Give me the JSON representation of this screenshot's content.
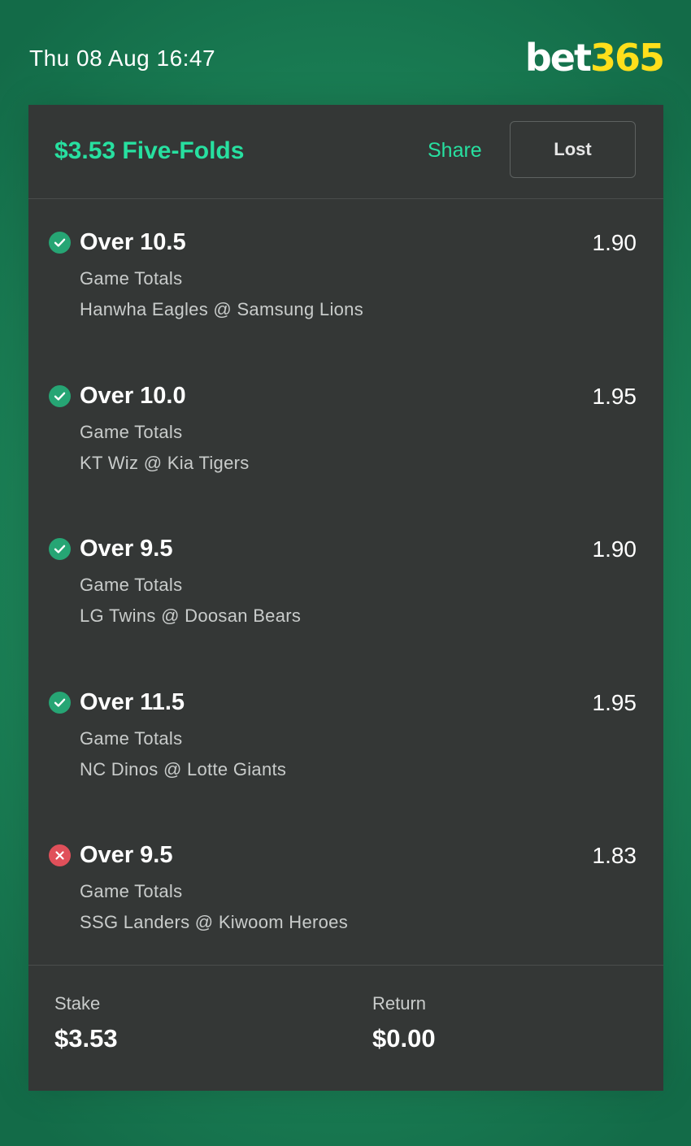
{
  "header": {
    "datetime": "Thu 08 Aug 16:47",
    "logo_part1": "bet",
    "logo_part2": "365"
  },
  "bet": {
    "title": "$3.53 Five-Folds",
    "share_label": "Share",
    "status_label": "Lost"
  },
  "selections": [
    {
      "name": "Over 10.5",
      "odds": "1.90",
      "market": "Game Totals",
      "event": "Hanwha Eagles @ Samsung Lions",
      "result": "won"
    },
    {
      "name": "Over 10.0",
      "odds": "1.95",
      "market": "Game Totals",
      "event": "KT Wiz @ Kia Tigers",
      "result": "won"
    },
    {
      "name": "Over 9.5",
      "odds": "1.90",
      "market": "Game Totals",
      "event": "LG Twins @ Doosan Bears",
      "result": "won"
    },
    {
      "name": "Over 11.5",
      "odds": "1.95",
      "market": "Game Totals",
      "event": "NC Dinos @ Lotte Giants",
      "result": "won"
    },
    {
      "name": "Over 9.5",
      "odds": "1.83",
      "market": "Game Totals",
      "event": "SSG Landers @ Kiwoom Heroes",
      "result": "lost"
    }
  ],
  "footer": {
    "stake_label": "Stake",
    "stake_value": "$3.53",
    "return_label": "Return",
    "return_value": "$0.00"
  },
  "colors": {
    "accent": "#27e0a0",
    "won": "#26a574",
    "lost": "#e0505a",
    "logo_yellow": "#ffdf1b",
    "card_bg": "#343736"
  },
  "icons": {
    "won": "check-circle-icon",
    "lost": "cross-circle-icon"
  }
}
